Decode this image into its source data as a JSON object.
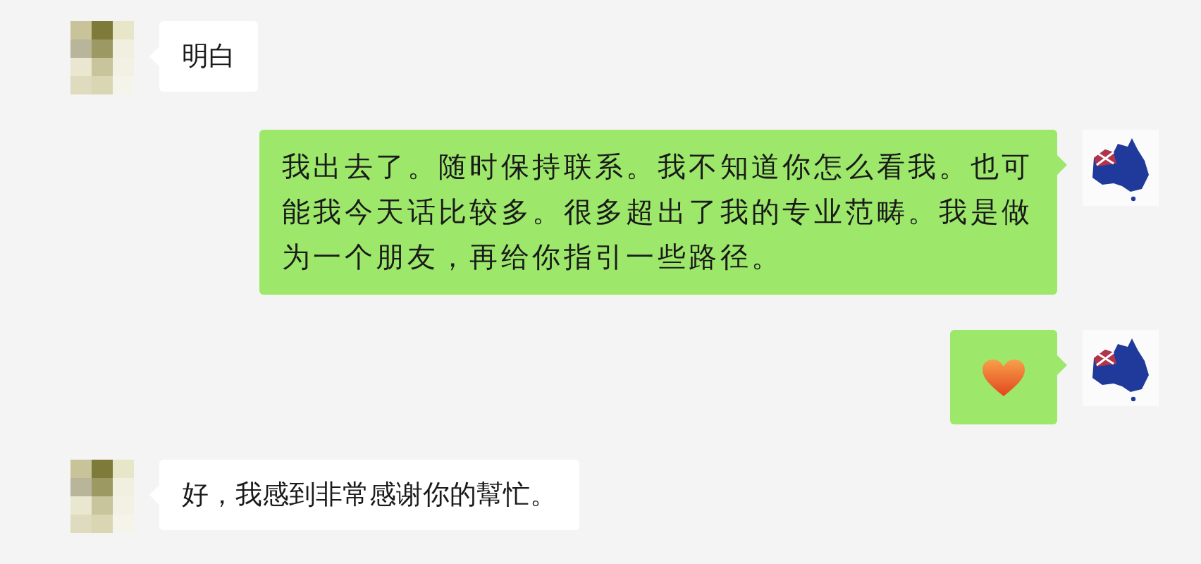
{
  "messages": [
    {
      "outgoing": false,
      "kind": "text",
      "text": "明白"
    },
    {
      "outgoing": true,
      "kind": "text",
      "text": "我出去了。随时保持联系。我不知道你怎么看我。也可能我今天话比较多。很多超出了我的专业范畴。我是做为一个朋友，再给你指引一些路径。"
    },
    {
      "outgoing": true,
      "kind": "heart"
    },
    {
      "outgoing": false,
      "kind": "text",
      "text": "好，我感到非常感谢你的幫忙。"
    }
  ]
}
